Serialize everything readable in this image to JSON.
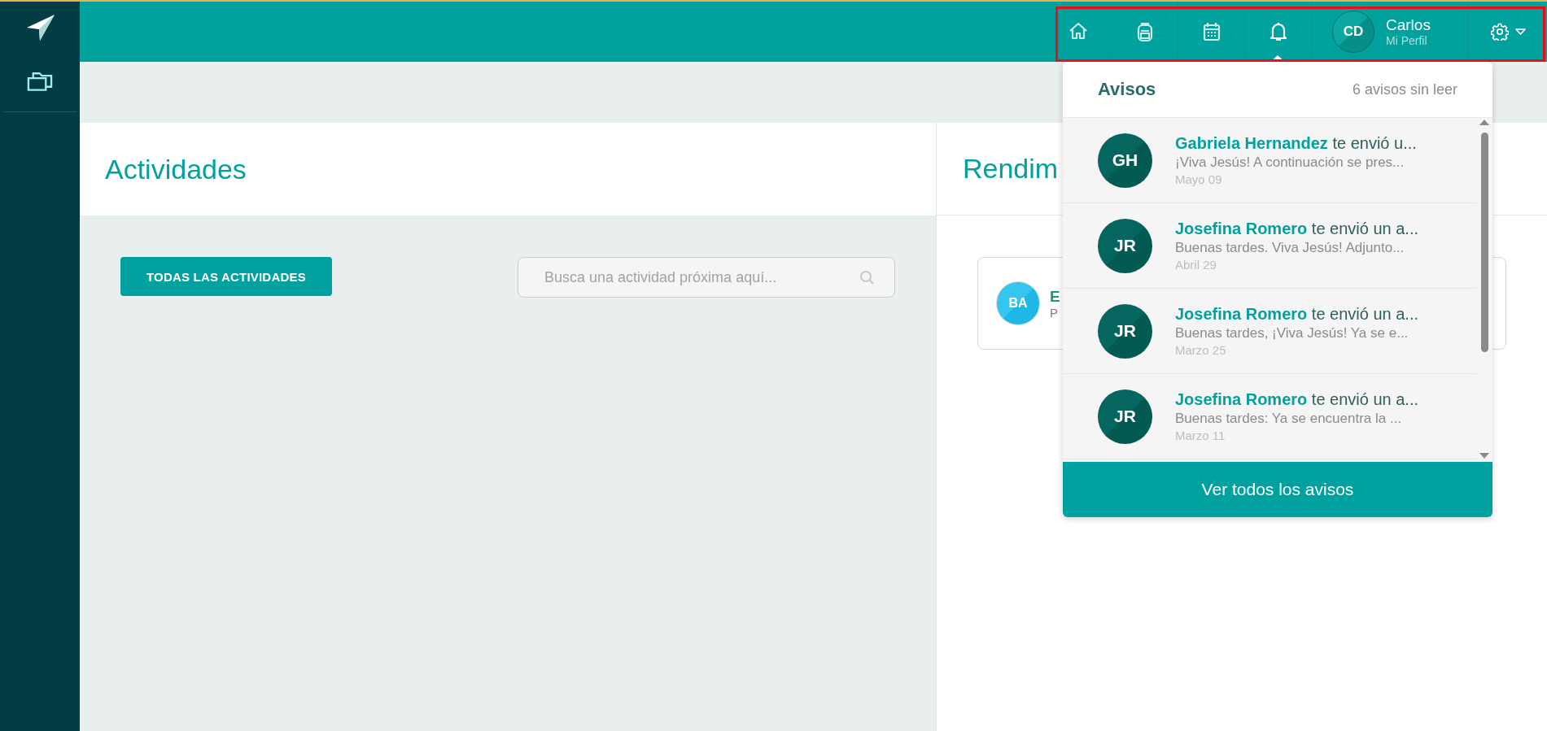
{
  "sidebar": {
    "items": [
      {
        "selected": false
      }
    ]
  },
  "top_bar": {
    "nav": [
      {
        "selected": false
      },
      {
        "selected": false
      },
      {
        "selected": false
      },
      {
        "selected": true
      }
    ],
    "profile": {
      "initials": "CD",
      "name": "Carlos",
      "link": "Mi Perfil"
    }
  },
  "activities": {
    "title": "Actividades",
    "button": "TODAS LAS ACTIVIDADES",
    "search": {
      "placeholder": "Busca una actividad próxima aquí..."
    }
  },
  "performance": {
    "title": "Rendim",
    "card": {
      "initials": "BA",
      "title": "E",
      "subtitle": "P"
    }
  },
  "notifications": {
    "title": "Avisos",
    "unread": "6 avisos sin leer",
    "items": [
      {
        "initials": "GH",
        "sender": "Gabriela Hernandez",
        "text": "te envió u...",
        "preview": "¡Viva Jesús! A continuación se pres...",
        "date": "Mayo 09"
      },
      {
        "initials": "JR",
        "sender": "Josefina Romero",
        "text": "te envió un a...",
        "preview": "Buenas tardes. Viva Jesús! Adjunto...",
        "date": "Abril 29"
      },
      {
        "initials": "JR",
        "sender": "Josefina Romero",
        "text": "te envió un a...",
        "preview": "Buenas tardes, ¡Viva Jesús! Ya se e...",
        "date": "Marzo 25"
      },
      {
        "initials": "JR",
        "sender": "Josefina Romero",
        "text": "te envió un a...",
        "preview": "Buenas tardes: Ya se encuentra la ...",
        "date": "Marzo 11"
      }
    ],
    "footer": "Ver todos los avisos"
  }
}
